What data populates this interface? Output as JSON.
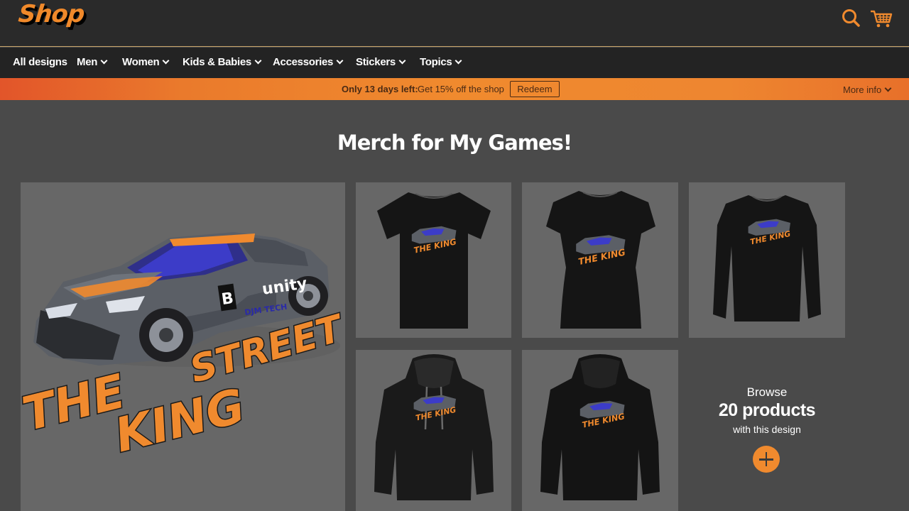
{
  "header": {
    "logo": "Shop",
    "icons": [
      "search-icon",
      "cart-icon"
    ],
    "accent": "#f08a2e"
  },
  "nav": {
    "items": [
      {
        "label": "All designs",
        "dropdown": false
      },
      {
        "label": "Men",
        "dropdown": true
      },
      {
        "label": "Women",
        "dropdown": true
      },
      {
        "label": "Kids & Babies",
        "dropdown": true
      },
      {
        "label": "Accessories",
        "dropdown": true
      },
      {
        "label": "Stickers",
        "dropdown": true
      },
      {
        "label": "Topics",
        "dropdown": true
      }
    ]
  },
  "promo": {
    "strong": "Only 13 days left:",
    "text": "Get 15% off the shop",
    "button": "Redeem",
    "more": "More info"
  },
  "page": {
    "title": "Merch for My Games!"
  },
  "design": {
    "line1": "STREET",
    "line2": "THE",
    "line3": "KING",
    "car_text_unity": "unity",
    "car_text_badge": "B",
    "car_text_dev": "DJM TECH"
  },
  "products": [
    {
      "type": "t-shirt-men",
      "color": "black"
    },
    {
      "type": "t-shirt-women",
      "color": "black"
    },
    {
      "type": "long-sleeve",
      "color": "black"
    },
    {
      "type": "hoodie-men",
      "color": "black"
    },
    {
      "type": "hoodie-premium",
      "color": "black"
    }
  ],
  "browse": {
    "line1": "Browse",
    "count": "20 products",
    "line3": "with this design"
  }
}
